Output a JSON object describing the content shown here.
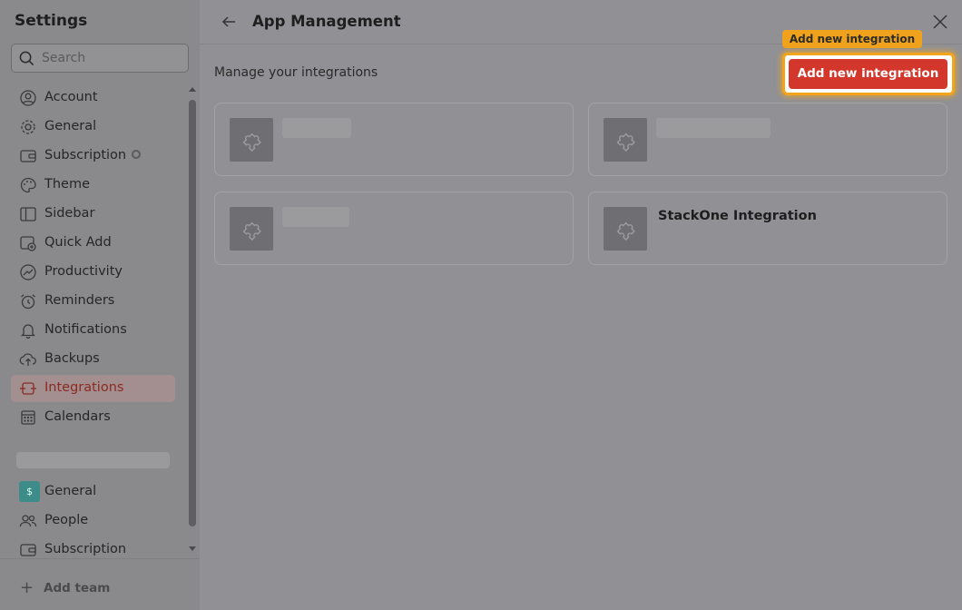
{
  "sidebar": {
    "title": "Settings",
    "search_placeholder": "Search",
    "items": [
      {
        "label": "Account",
        "icon": "user-circle-icon"
      },
      {
        "label": "General",
        "icon": "gear-icon"
      },
      {
        "label": "Subscription",
        "icon": "wallet-icon"
      },
      {
        "label": "Theme",
        "icon": "palette-icon"
      },
      {
        "label": "Sidebar",
        "icon": "sidebar-layout-icon"
      },
      {
        "label": "Quick Add",
        "icon": "calendar-plus-icon"
      },
      {
        "label": "Productivity",
        "icon": "trend-up-icon"
      },
      {
        "label": "Reminders",
        "icon": "alarm-clock-icon"
      },
      {
        "label": "Notifications",
        "icon": "bell-icon"
      },
      {
        "label": "Backups",
        "icon": "cloud-upload-icon"
      },
      {
        "label": "Integrations",
        "icon": "plug-icon",
        "active": true
      },
      {
        "label": "Calendars",
        "icon": "calendar-grid-icon"
      }
    ],
    "team_items": [
      {
        "label": "General",
        "icon_letter": "$"
      },
      {
        "label": "People",
        "icon": "people-icon"
      },
      {
        "label": "Subscription",
        "icon": "wallet-icon"
      }
    ],
    "add_team_label": "Add team"
  },
  "header": {
    "title": "App Management"
  },
  "main": {
    "subtitle": "Manage your integrations",
    "tooltip": "Add new integration",
    "add_button_label": "Add new integration",
    "cards": [
      {
        "name": ""
      },
      {
        "name": ""
      },
      {
        "name": ""
      },
      {
        "name": "StackOne Integration"
      }
    ]
  },
  "colors": {
    "accent": "#d3372b",
    "highlight": "#f2a51c",
    "team_icon": "#3d8c8a"
  }
}
